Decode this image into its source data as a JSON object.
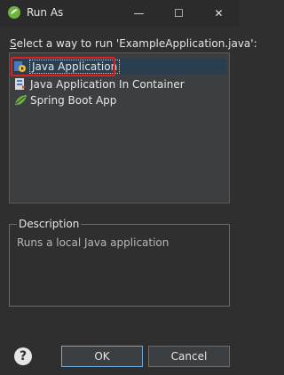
{
  "window": {
    "title": "Run As",
    "controls": {
      "minimize": "—",
      "maximize": "☐",
      "close": "✕"
    }
  },
  "prompt": {
    "mnemonic": "S",
    "rest": "elect a way to run 'ExampleApplication.java':"
  },
  "launchers": [
    {
      "label": "Java Application",
      "icon": "java-application-icon",
      "selected": true
    },
    {
      "label": "Java Application In Container",
      "icon": "java-container-icon",
      "selected": false
    },
    {
      "label": "Spring Boot App",
      "icon": "spring-boot-icon",
      "selected": false
    }
  ],
  "description": {
    "title": "Description",
    "text": "Runs a local Java application"
  },
  "buttons": {
    "help": "?",
    "ok": "OK",
    "cancel": "Cancel"
  },
  "colors": {
    "accent": "#6fa8dc",
    "highlight": "#e02020",
    "spring": "#6db33f"
  }
}
